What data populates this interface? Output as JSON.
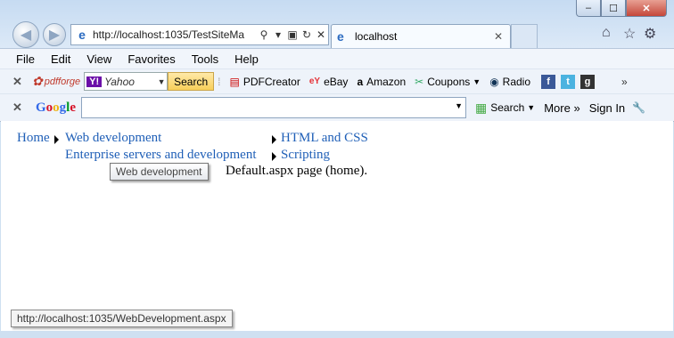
{
  "window": {
    "address_url": "http://localhost:1035/TestSiteMa",
    "tab_title": "localhost"
  },
  "menu": [
    "File",
    "Edit",
    "View",
    "Favorites",
    "Tools",
    "Help"
  ],
  "toolbar1": {
    "pdfforge": "pdfforge",
    "yahoo_label": "Yahoo",
    "search_button": "Search",
    "items": [
      "PDFCreator",
      "eBay",
      "Amazon",
      "Coupons",
      "Radio"
    ]
  },
  "toolbar2": {
    "google": "Google",
    "search_label": "Search",
    "more_label": "More",
    "signin_label": "Sign In"
  },
  "page": {
    "home": "Home",
    "web_development": "Web development",
    "html_css": "HTML and CSS",
    "enterprise": "Enterprise servers and development",
    "scripting": "Scripting",
    "body_text": "Default.aspx page (home).",
    "tooltip": "Web development"
  },
  "status_url": "http://localhost:1035/WebDevelopment.aspx"
}
